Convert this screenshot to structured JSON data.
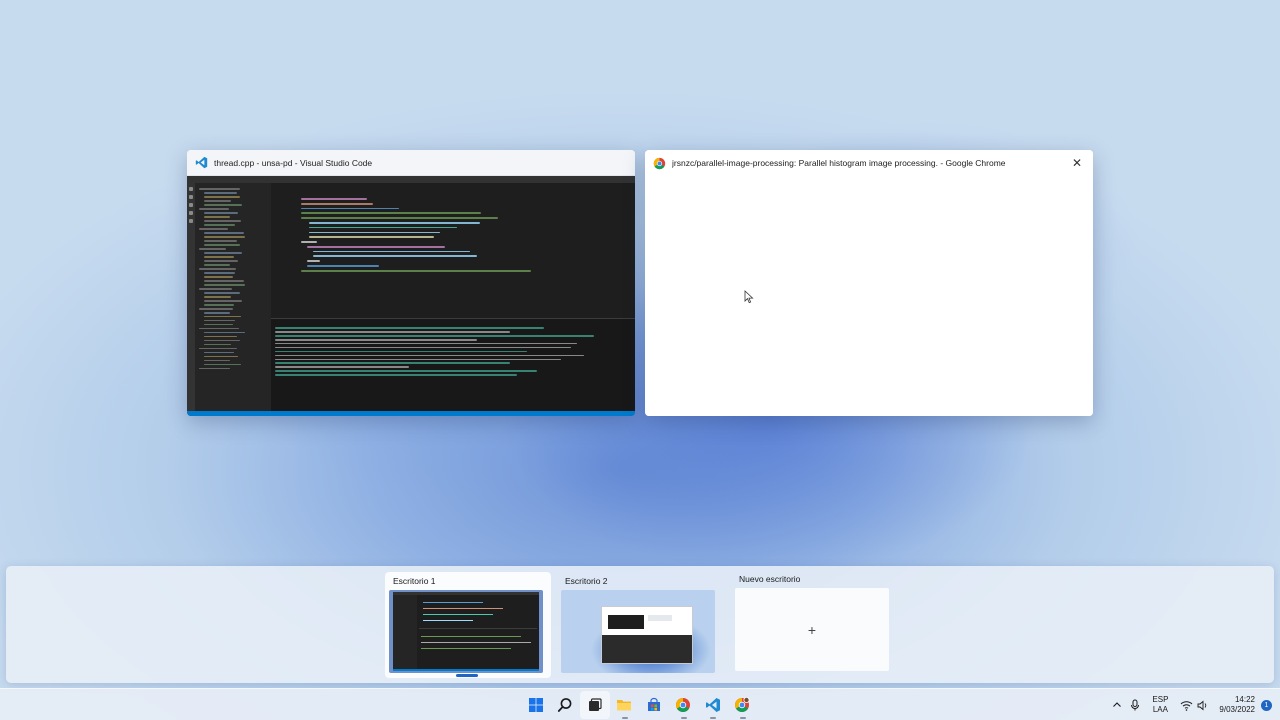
{
  "windows": [
    {
      "id": "vscode",
      "title": "thread.cpp - unsa-pd - Visual Studio Code",
      "icon": "vscode-icon"
    },
    {
      "id": "chrome",
      "title": "jrsnzc/parallel-image-processing: Parallel histogram image processing. - Google Chrome",
      "icon": "chrome-icon",
      "close_label": "✕"
    }
  ],
  "desktops": {
    "items": [
      {
        "label": "Escritorio 1",
        "active": true
      },
      {
        "label": "Escritorio 2",
        "active": false
      }
    ],
    "new_label": "Nuevo escritorio",
    "new_icon_glyph": "+"
  },
  "taskbar": {
    "apps": [
      "windows-start-icon",
      "search-icon",
      "task-view-icon",
      "file-explorer-icon",
      "microsoft-store-icon",
      "chrome-icon",
      "vscode-icon",
      "chrome-profile-icon"
    ]
  },
  "tray": {
    "lang_line1": "ESP",
    "lang_line2": "LAA",
    "time": "14:22",
    "date": "9/03/2022",
    "notification_count": "1"
  },
  "colors": {
    "accent": "#1f66c2",
    "vscode_bg": "#1e1e1e",
    "vscode_status": "#007acc"
  }
}
